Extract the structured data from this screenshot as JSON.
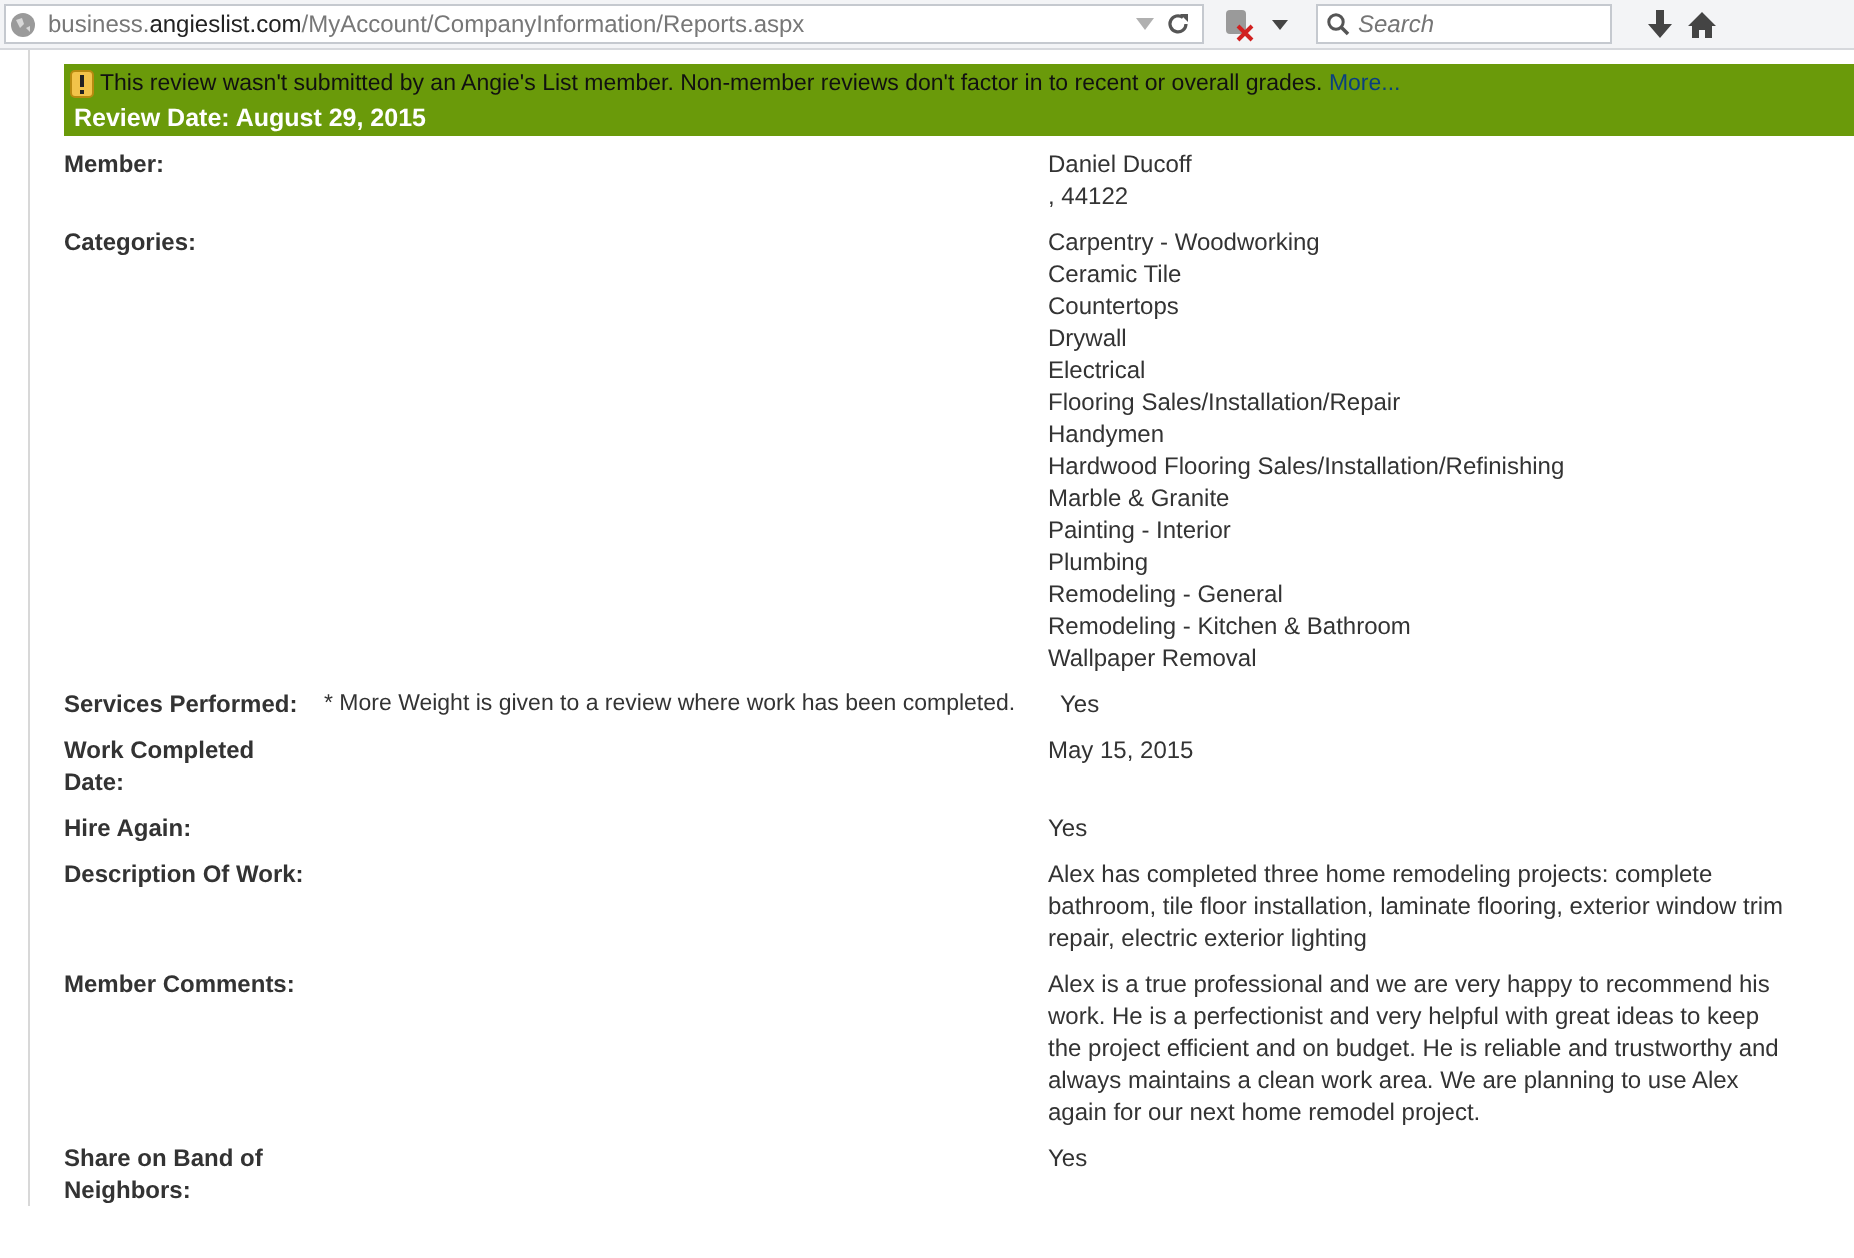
{
  "browser": {
    "url_subdomain": "business.",
    "url_domain": "angieslist.com",
    "url_path": "/MyAccount/CompanyInformation/Reports.aspx",
    "search": {
      "placeholder": "Search"
    }
  },
  "banner": {
    "notice": "This review wasn't submitted by an Angie's List member. Non-member reviews don't factor in to recent or overall grades.",
    "link": "More...",
    "title": "Review Date: August 29, 2015"
  },
  "rows": [
    {
      "label": "Member:",
      "lines": [
        "Daniel Ducoff",
        ", 44122"
      ]
    },
    {
      "label": "Categories:",
      "lines": [
        "Carpentry - Woodworking",
        "Ceramic Tile",
        "Countertops",
        "Drywall",
        "Electrical",
        "Flooring Sales/Installation/Repair",
        "Handymen",
        "Hardwood Flooring Sales/Installation/Refinishing",
        "Marble & Granite",
        "Painting - Interior",
        "Plumbing",
        "Remodeling - General",
        "Remodeling - Kitchen & Bathroom",
        "Wallpaper Removal"
      ]
    },
    {
      "label": "Services Performed:",
      "note": "* More Weight is given to a review where work has been completed.",
      "lines": [
        "Yes"
      ]
    },
    {
      "label": "Work Completed Date:",
      "lines": [
        "May 15, 2015"
      ]
    },
    {
      "label": "Hire Again:",
      "lines": [
        "Yes"
      ]
    },
    {
      "label": "Description Of Work:",
      "lines": [
        "Alex has completed three home remodeling projects: complete bathroom, tile floor installation, laminate flooring, exterior window trim repair, electric exterior lighting"
      ]
    },
    {
      "label": "Member Comments:",
      "lines": [
        "Alex is a true professional and we are very happy to recommend his work. He is a perfectionist and very helpful with great ideas to keep the project efficient and on budget. He is reliable and trustworthy and always maintains a clean work area. We are planning to use Alex again for our next home remodel project."
      ]
    },
    {
      "label": "Share on Band of Neighbors:",
      "lines": [
        "Yes"
      ]
    }
  ]
}
